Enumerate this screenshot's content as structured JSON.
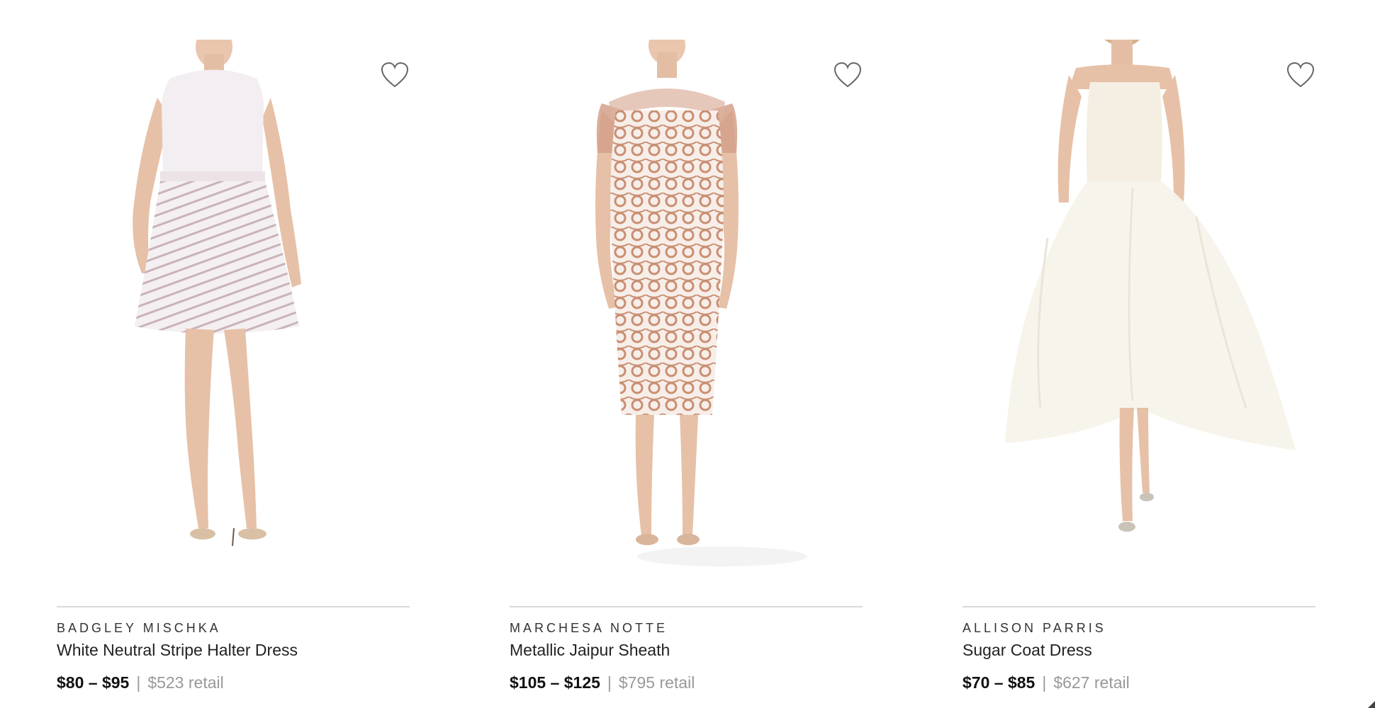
{
  "products": [
    {
      "brand": "BADGLEY MISCHKA",
      "name": "White Neutral Stripe Halter Dress",
      "price": "$80 – $95",
      "separator": "|",
      "retail": "$523 retail",
      "favorite_icon": "heart-outline-icon",
      "dress_color": "#f2ecee"
    },
    {
      "brand": "MARCHESA NOTTE",
      "name": "Metallic Jaipur Sheath",
      "price": "$105 – $125",
      "separator": "|",
      "retail": "$795 retail",
      "favorite_icon": "heart-outline-icon",
      "dress_color": "#e7c2ad"
    },
    {
      "brand": "ALLISON PARRIS",
      "name": "Sugar Coat Dress",
      "price": "$70 – $85",
      "separator": "|",
      "retail": "$627 retail",
      "favorite_icon": "heart-outline-icon",
      "dress_color": "#f6f2e8"
    }
  ]
}
